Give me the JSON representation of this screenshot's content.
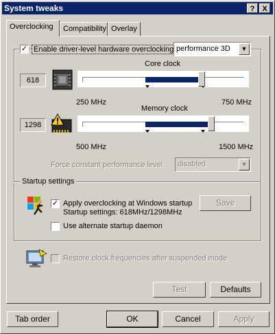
{
  "window": {
    "title": "System tweaks"
  },
  "titlebar_buttons": {
    "help": "?",
    "close": "X"
  },
  "tabs": [
    {
      "label": "Overclocking",
      "active": true
    },
    {
      "label": "Compatibility",
      "active": false
    },
    {
      "label": "Overlay",
      "active": false
    }
  ],
  "overclocking": {
    "enable_label": "Enable driver-level hardware overclocking",
    "enable_checked": true,
    "mode_value": "performance 3D",
    "core": {
      "label": "Core clock",
      "value": "618",
      "min_label": "250 MHz",
      "max_label": "750 MHz",
      "fraction": 0.736
    },
    "memory": {
      "label": "Memory clock",
      "value": "1298",
      "min_label": "500 MHz",
      "max_label": "1500 MHz",
      "fraction": 0.798
    },
    "force_level_label": "Force constant performance level",
    "force_level_value": "disabled"
  },
  "startup": {
    "group_label": "Startup settings",
    "apply_label": "Apply overclocking at Windows startup",
    "apply_checked": true,
    "settings_text": "Startup settings: 618MHz/1298MHz",
    "save_label": "Save",
    "daemon_label": "Use alternate startup daemon",
    "daemon_checked": false
  },
  "restore": {
    "label": "Restore clock frequencies after suspended mode",
    "checked": false
  },
  "panel_buttons": {
    "test": "Test",
    "defaults": "Defaults"
  },
  "dialog_buttons": {
    "tab_order": "Tab order",
    "ok": "OK",
    "cancel": "Cancel",
    "apply": "Apply"
  },
  "colors": {
    "titlebar": "#0a246a",
    "slider_range": "#0a246a",
    "face": "#d4d0c8"
  },
  "icons": {
    "gpu": "gpu-chip-icon",
    "memory": "memory-warning-icon",
    "startup": "startup-figure-icon",
    "restore": "monitor-icon"
  }
}
